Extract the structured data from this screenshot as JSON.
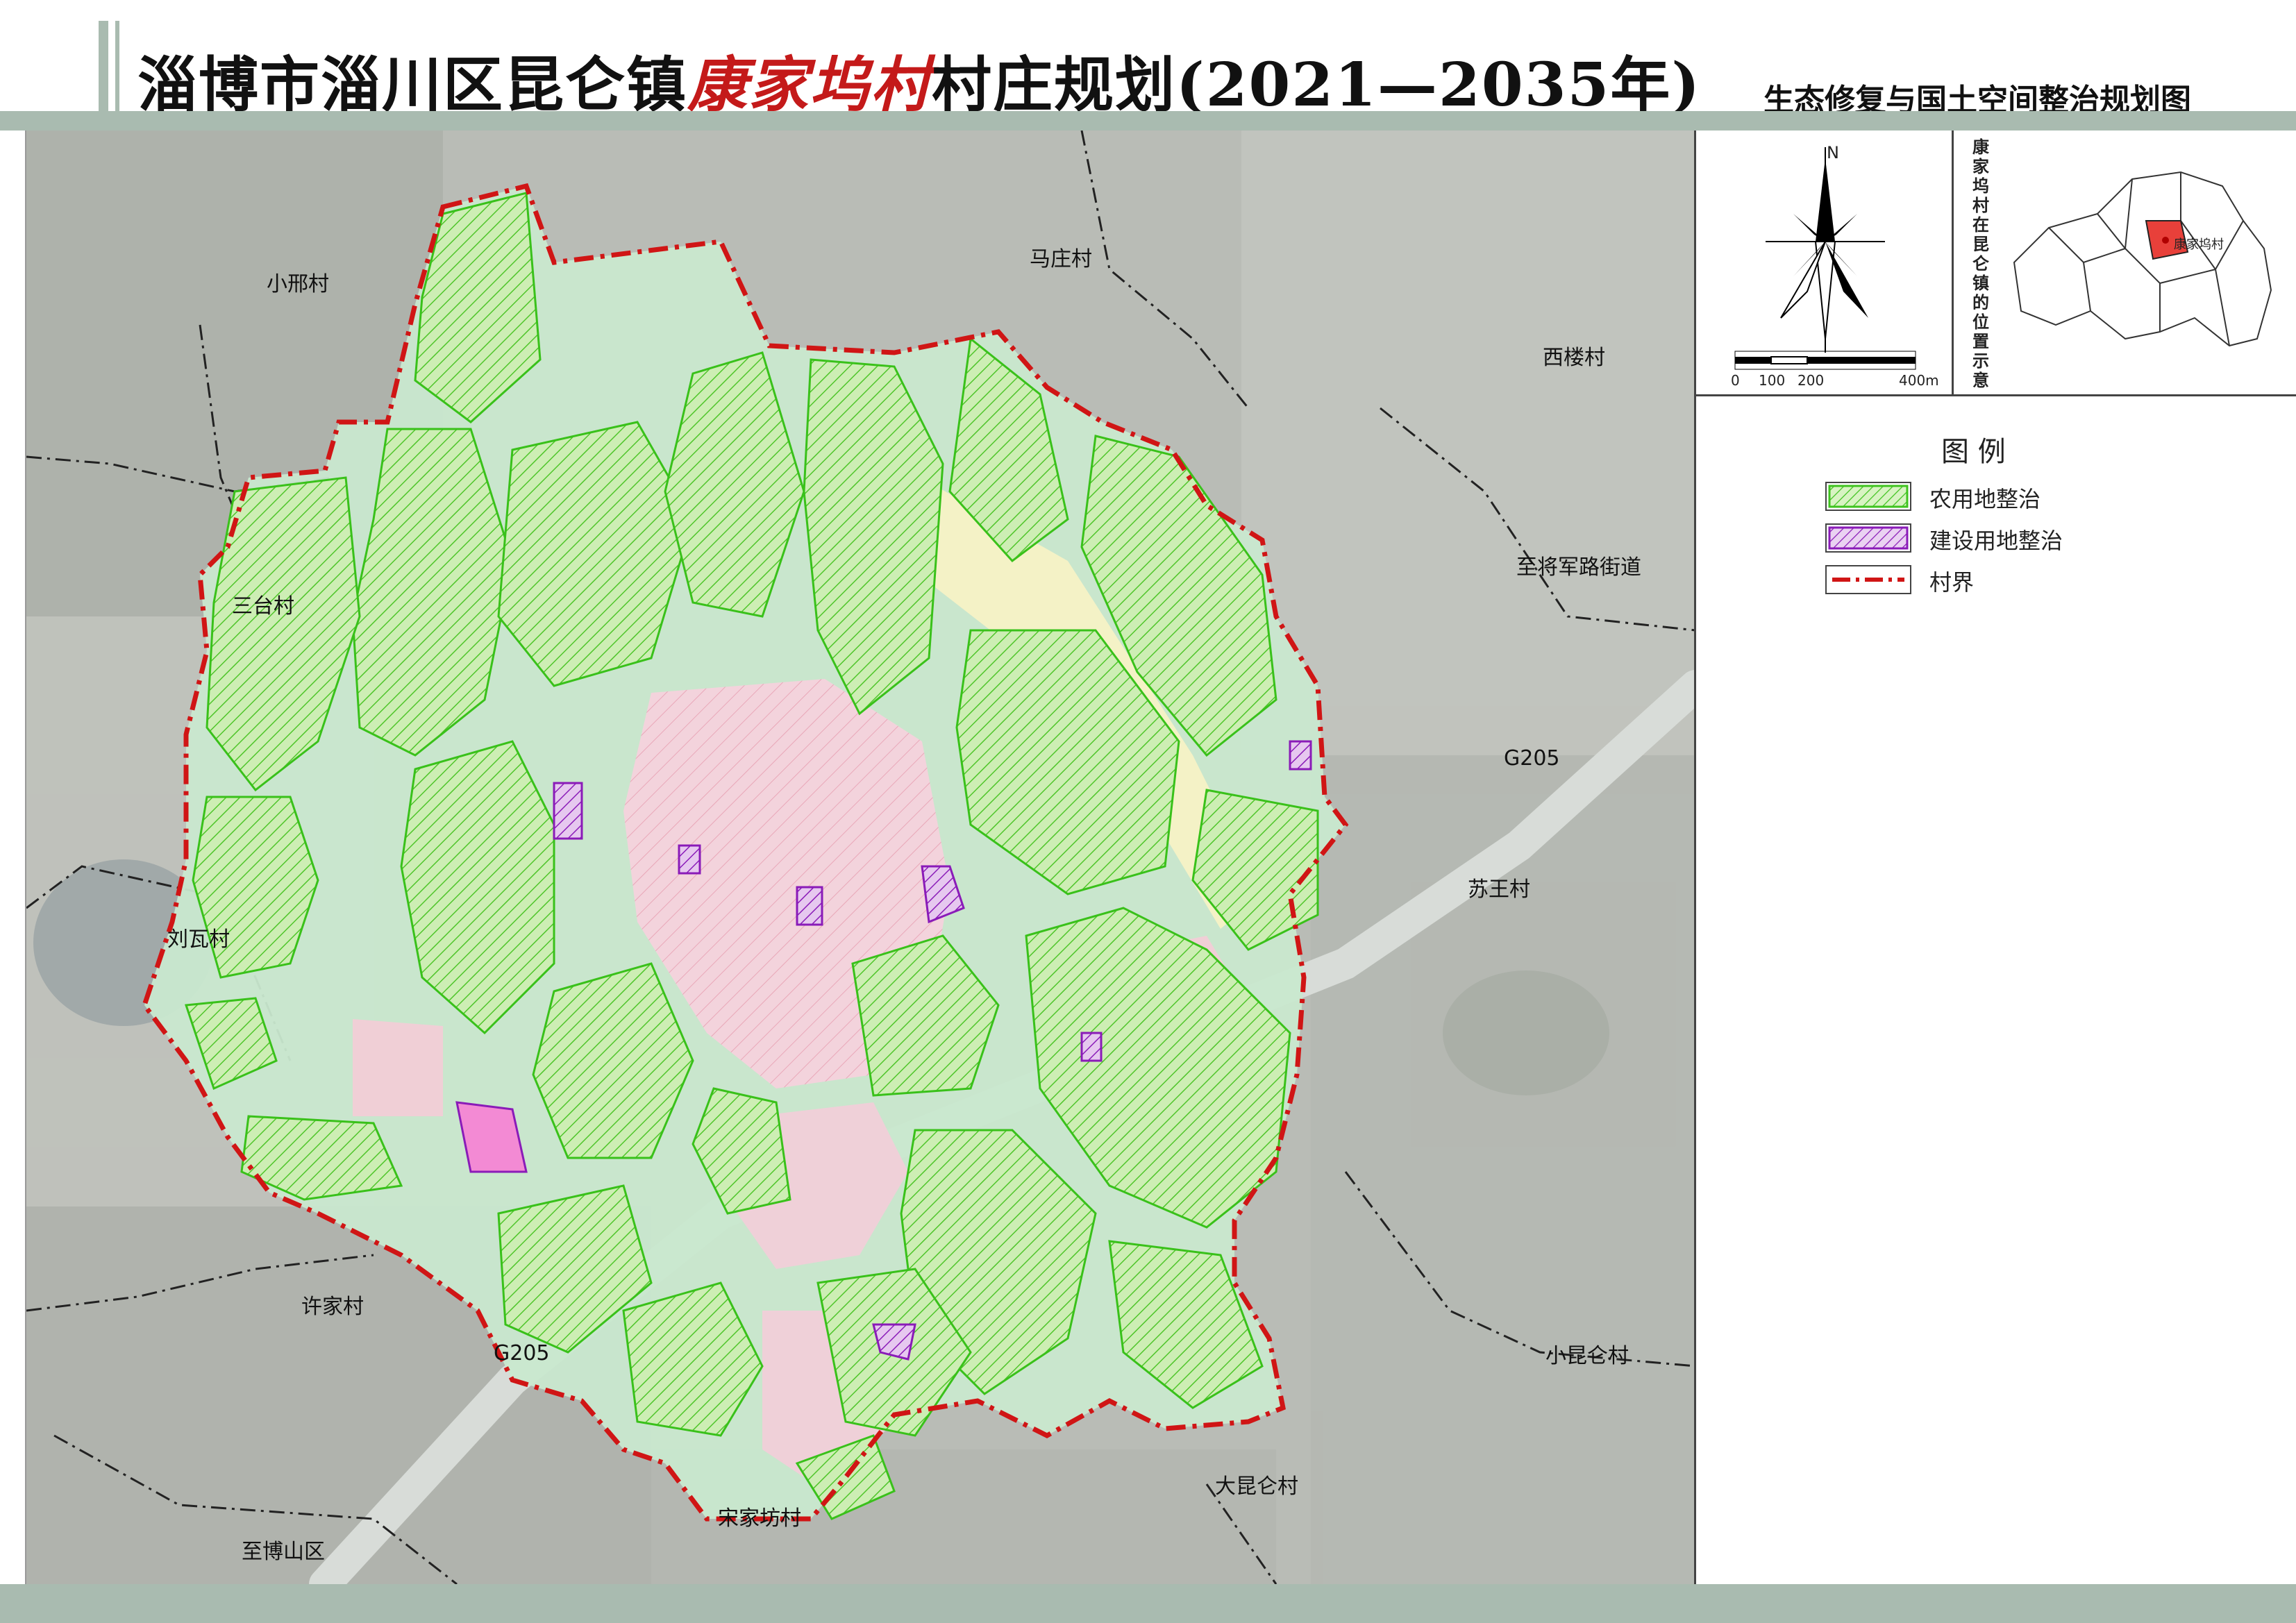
{
  "title": {
    "prefix": "淄博市淄川区昆仑镇",
    "highlight": "康家坞村",
    "suffix": "村庄规划(2021—2035年)",
    "subtitle": "生态修复与国土空间整治规划图"
  },
  "map": {
    "labels": [
      {
        "id": "xiaoxing",
        "text": "小邢村"
      },
      {
        "id": "mazhuang",
        "text": "马庄村"
      },
      {
        "id": "xilou",
        "text": "西楼村"
      },
      {
        "id": "jiangjun",
        "text": "至将军路街道"
      },
      {
        "id": "santai",
        "text": "三台村"
      },
      {
        "id": "g205-east",
        "text": "G205"
      },
      {
        "id": "suwang",
        "text": "苏王村"
      },
      {
        "id": "liuwa",
        "text": "刘瓦村"
      },
      {
        "id": "xujia",
        "text": "许家村"
      },
      {
        "id": "g205-west",
        "text": "G205"
      },
      {
        "id": "xiaokunlun",
        "text": "小昆仑村"
      },
      {
        "id": "dakunlun",
        "text": "大昆仑村"
      },
      {
        "id": "songjiafang",
        "text": "宋家坊村"
      },
      {
        "id": "boshan",
        "text": "至博山区"
      }
    ]
  },
  "north_arrow": {
    "label": "N"
  },
  "scale_bar": {
    "ticks": [
      "0",
      "100",
      "200",
      "400m"
    ]
  },
  "locator": {
    "caption": "康家坞村在昆仑镇的位置示意",
    "marker_label": "康家坞村",
    "highlight_color": "#e8403a"
  },
  "legend": {
    "title": "图 例",
    "items": [
      {
        "label": "农用地整治",
        "color": "#3fc31f"
      },
      {
        "label": "建设用地整治",
        "color": "#8a1bb8"
      },
      {
        "label": "村界",
        "color": "#d01515"
      }
    ]
  }
}
